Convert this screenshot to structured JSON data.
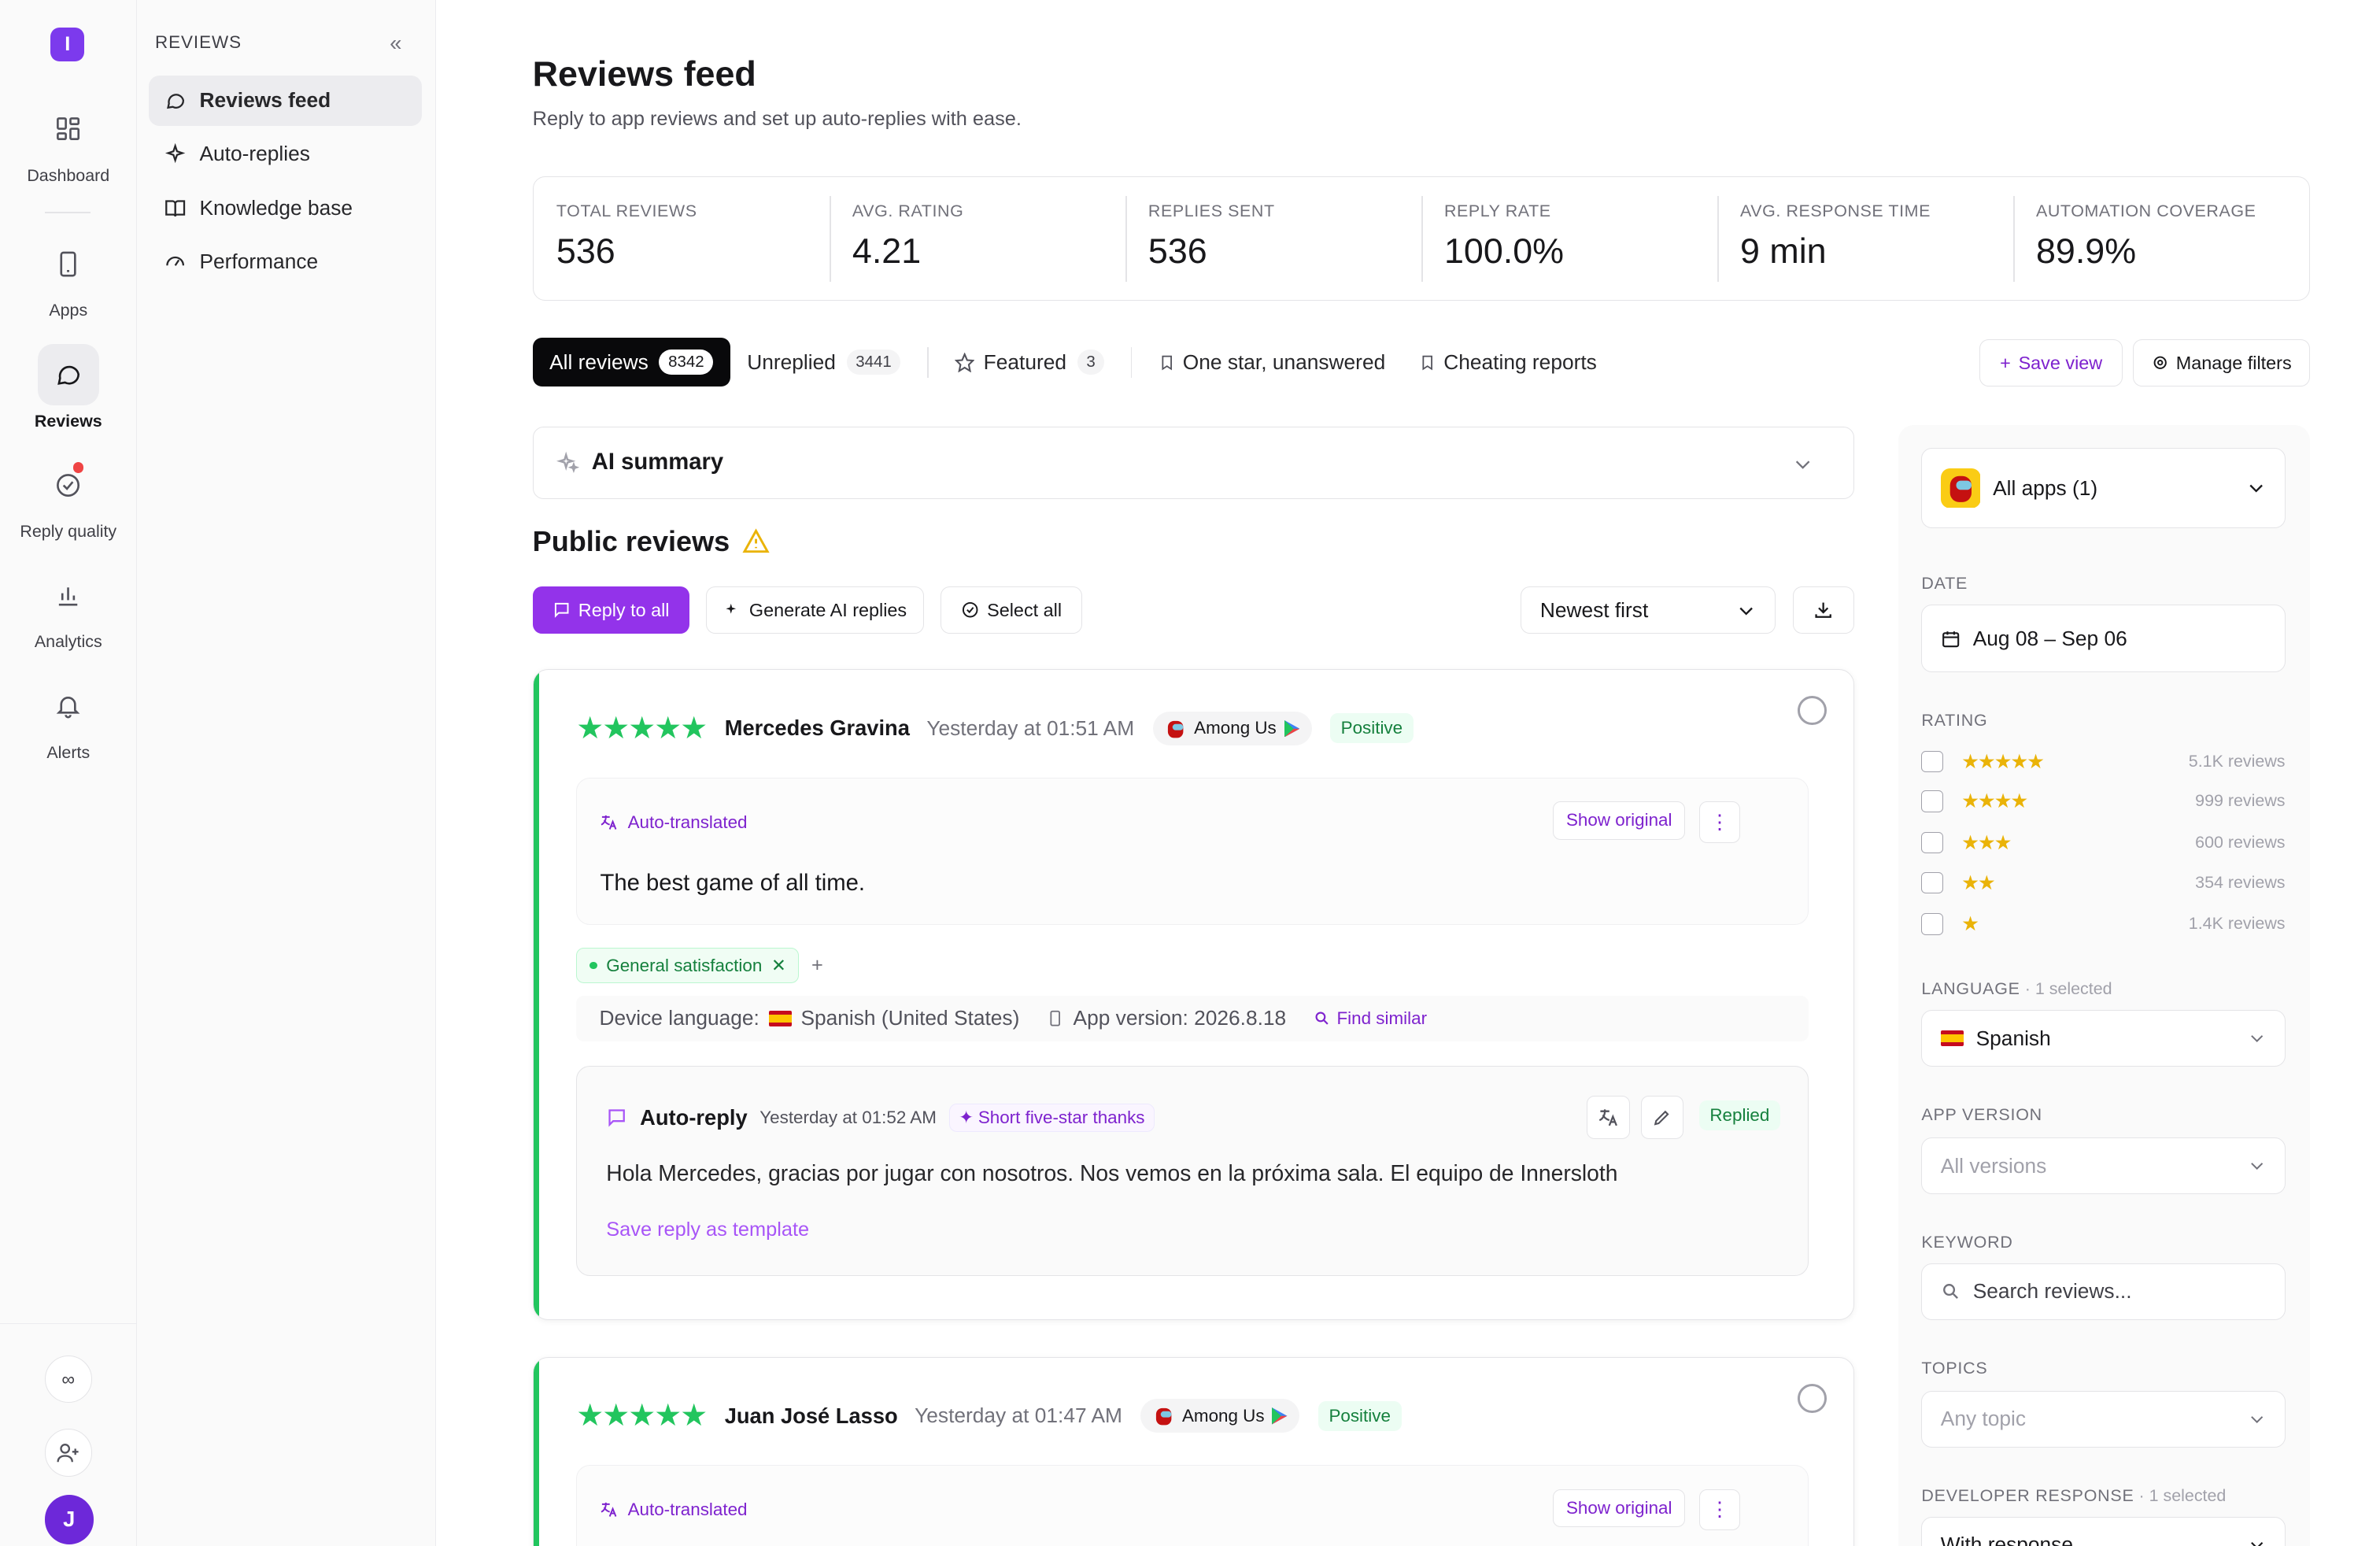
{
  "rail": {
    "logo": "I",
    "items": [
      {
        "label": "Dashboard"
      },
      {
        "label": "Apps"
      },
      {
        "label": "Reviews"
      },
      {
        "label": "Reply quality"
      },
      {
        "label": "Analytics"
      },
      {
        "label": "Alerts"
      }
    ],
    "bottom_link": "∞",
    "avatar": "J"
  },
  "subnav": {
    "heading": "REVIEWS",
    "items": [
      {
        "label": "Reviews feed"
      },
      {
        "label": "Auto-replies"
      },
      {
        "label": "Knowledge base"
      },
      {
        "label": "Performance"
      }
    ]
  },
  "page": {
    "title": "Reviews feed",
    "subtitle": "Reply to app reviews and set up auto-replies with ease."
  },
  "stats": [
    {
      "label": "TOTAL REVIEWS",
      "value": "536"
    },
    {
      "label": "AVG. RATING",
      "value": "4.21"
    },
    {
      "label": "REPLIES SENT",
      "value": "536"
    },
    {
      "label": "REPLY RATE",
      "value": "100.0%"
    },
    {
      "label": "AVG. RESPONSE TIME",
      "value": "9 min"
    },
    {
      "label": "AUTOMATION COVERAGE",
      "value": "89.9%"
    }
  ],
  "tabs": [
    {
      "label": "All reviews",
      "count": "8342"
    },
    {
      "label": "Unreplied",
      "count": "3441"
    },
    {
      "label": "Featured",
      "count": "3"
    },
    {
      "label": "One star, unanswered"
    },
    {
      "label": "Cheating reports"
    }
  ],
  "toolbar": {
    "save_view": "Save view",
    "manage_filters": "Manage filters"
  },
  "ai_summary": "AI summary",
  "public_reviews": "Public reviews",
  "actions": {
    "reply_all": "Reply to all",
    "generate": "Generate AI replies",
    "select_all": "Select all",
    "sort": "Newest first"
  },
  "reviews": [
    {
      "stars": "★★★★★",
      "rating": 5,
      "name": "Mercedes Gravina",
      "time": "Yesterday at 01:51 AM",
      "app": "Among Us",
      "sentiment": "Positive",
      "translated_label": "Auto-translated",
      "show_original": "Show original",
      "text": "The best game of all time.",
      "tag": "General satisfaction",
      "device_language_label": "Device language:",
      "device_language": "Spanish (United States)",
      "app_version": "App version: 2026.8.18",
      "find_similar": "Find similar",
      "reply": {
        "label": "Auto-reply",
        "time": "Yesterday at 01:52 AM",
        "template": "Short five-star thanks",
        "status": "Replied",
        "text": "Hola Mercedes, gracias por jugar con nosotros. Nos vemos en la próxima sala. El equipo de Innersloth",
        "save_template": "Save reply as template"
      }
    },
    {
      "stars": "★★★★★",
      "rating": 5,
      "name": "Juan José Lasso",
      "time": "Yesterday at 01:47 AM",
      "app": "Among Us",
      "sentiment": "Positive",
      "translated_label": "Auto-translated",
      "show_original": "Show original"
    }
  ],
  "filters": {
    "apps": "All apps (1)",
    "date_label": "DATE",
    "date": "Aug 08 – Sep 06",
    "rating_label": "RATING",
    "ratings": [
      {
        "stars": "★★★★★",
        "count": "5.1K reviews"
      },
      {
        "stars": "★★★★",
        "count": "999 reviews"
      },
      {
        "stars": "★★★",
        "count": "600 reviews"
      },
      {
        "stars": "★★",
        "count": "354 reviews"
      },
      {
        "stars": "★",
        "count": "1.4K reviews"
      }
    ],
    "language_label": "LANGUAGE",
    "language_sel": " · 1 selected",
    "language": "Spanish",
    "version_label": "APP VERSION",
    "version": "All versions",
    "keyword_label": "KEYWORD",
    "keyword_ph": "Search reviews...",
    "topics_label": "TOPICS",
    "topics": "Any topic",
    "dev_label": "DEVELOPER RESPONSE",
    "dev_sel": " · 1 selected",
    "dev": "With response"
  },
  "colors": {
    "accent": "#7c3aed",
    "positive": "#22c55e",
    "star_yellow": "#eab308"
  }
}
